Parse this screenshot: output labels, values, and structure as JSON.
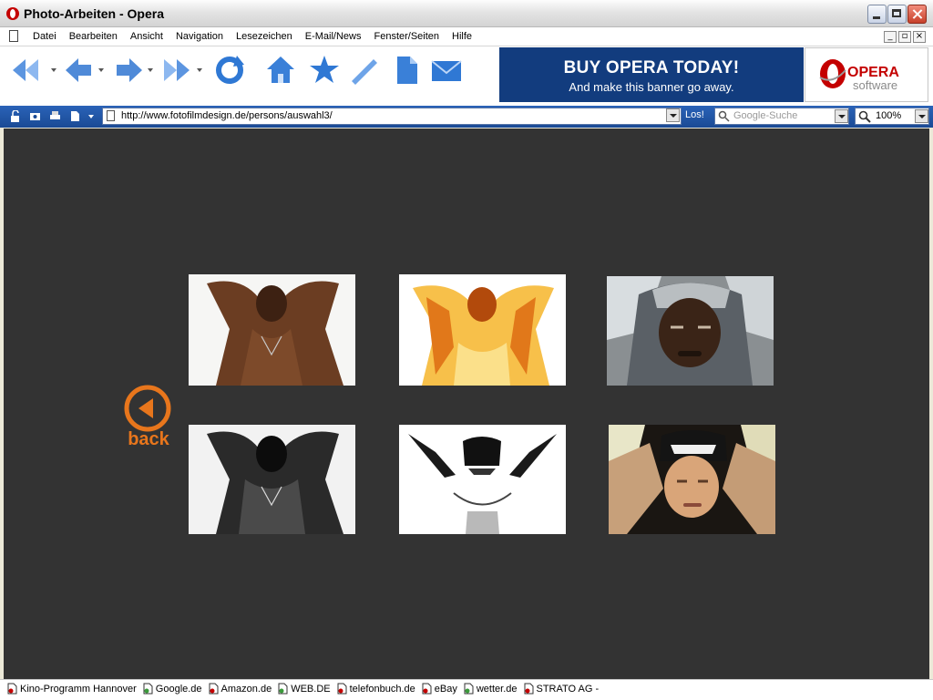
{
  "window": {
    "title": "Photo-Arbeiten - Opera"
  },
  "menu": {
    "items": [
      "Datei",
      "Bearbeiten",
      "Ansicht",
      "Navigation",
      "Lesezeichen",
      "E-Mail/News",
      "Fenster/Seiten",
      "Hilfe"
    ]
  },
  "toolbar": {
    "icons": [
      "rewind-icon",
      "back-icon",
      "forward-icon",
      "fast-forward-icon",
      "reload-icon",
      "home-icon",
      "star-icon",
      "edit-icon",
      "page-icon",
      "mail-icon"
    ]
  },
  "banner": {
    "headline": "BUY OPERA TODAY!",
    "subline": "And make this banner go away.",
    "logo_word": "OPERA",
    "logo_sub": "software"
  },
  "address": {
    "url": "http://www.fotofilmdesign.de/persons/auswahl3/",
    "go_label": "Los!",
    "search_placeholder": "Google-Suche",
    "zoom": "100%"
  },
  "page": {
    "background": "#333333",
    "back_label": "back",
    "accent_color": "#e8761c",
    "thumbnails": [
      {
        "name": "thumb-portrait-color"
      },
      {
        "name": "thumb-portrait-solarized"
      },
      {
        "name": "thumb-portrait-hooded"
      },
      {
        "name": "thumb-portrait-bw"
      },
      {
        "name": "thumb-portrait-highcontrast"
      },
      {
        "name": "thumb-portrait-cap"
      }
    ]
  },
  "bookmarks": [
    "Kino-Programm  Hannover",
    "Google.de",
    "Amazon.de",
    "WEB.DE",
    "telefonbuch.de",
    "eBay",
    "wetter.de",
    "STRATO AG -"
  ]
}
